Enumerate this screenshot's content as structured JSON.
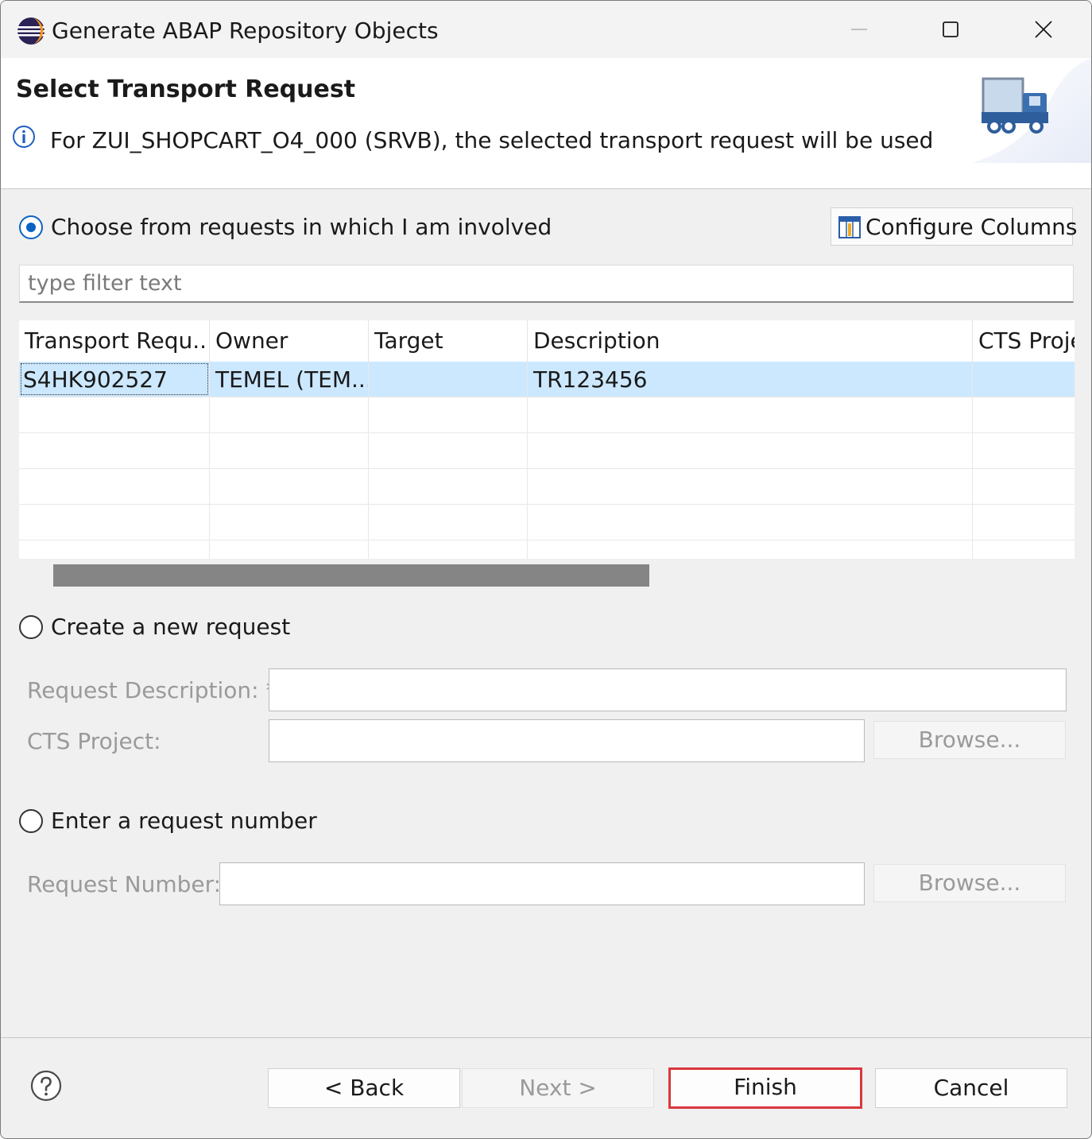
{
  "window": {
    "title": "Generate ABAP Repository Objects",
    "controls": [
      "minimize-icon",
      "maximize-icon",
      "close-icon"
    ]
  },
  "header": {
    "title": "Select Transport Request",
    "message_icon": "info-icon",
    "message": "For ZUI_SHOPCART_O4_000 (SRVB), the selected transport request will be used",
    "graphic_icon": "transport-truck-icon"
  },
  "options": {
    "choose_existing": {
      "label": "Choose from requests in which I am involved",
      "selected": true
    },
    "create_new": {
      "label": "Create a new request",
      "selected": false
    },
    "enter_number": {
      "label": "Enter a request number",
      "selected": false
    }
  },
  "configure_columns": {
    "label": "Configure Columns",
    "icon": "configure-columns-icon"
  },
  "filter": {
    "placeholder": "type filter text",
    "value": ""
  },
  "table": {
    "columns": [
      "Transport Requ...",
      "Owner",
      "Target",
      "Description",
      "CTS Proje"
    ],
    "rows": [
      [
        "S4HK902527",
        "TEMEL (TEM...",
        "",
        "TR123456",
        ""
      ]
    ]
  },
  "new_request": {
    "description_label": "Request Description: *",
    "description_value": "",
    "cts_label": "CTS Project:",
    "cts_value": "",
    "browse_label": "Browse..."
  },
  "request_number": {
    "label": "Request Number:",
    "value": "",
    "browse_label": "Browse..."
  },
  "footer": {
    "help_icon": "help-icon",
    "back": "< Back",
    "next": "Next >",
    "finish": "Finish",
    "cancel": "Cancel"
  },
  "colors": {
    "accent": "#0a63c4",
    "selection": "#cce8ff",
    "highlight": "#d9383e"
  }
}
